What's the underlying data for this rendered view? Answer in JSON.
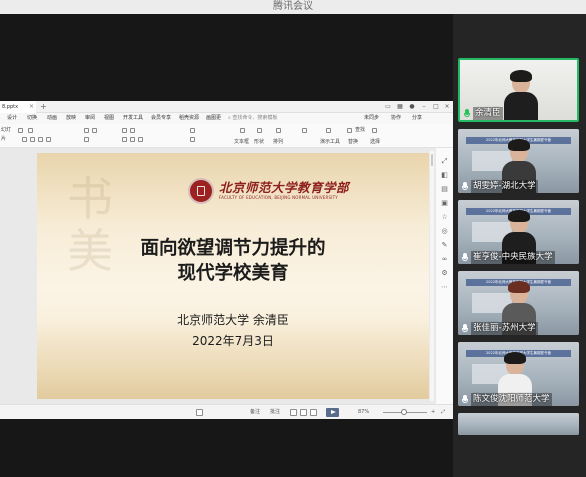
{
  "window": {
    "title": "腾讯会议"
  },
  "presentation_app": {
    "doc_tab": "8.pptx",
    "menu": [
      "设计",
      "切换",
      "动画",
      "放映",
      "审阅",
      "视图",
      "开发工具",
      "会员专享",
      "稻壳资源",
      "画图更"
    ],
    "search_placeholder": "查找命令、搜索模板",
    "menu_right": [
      "未同步",
      "协作",
      "分享"
    ],
    "toolbar_left": [
      "幻灯",
      "片"
    ],
    "toolbar_right": [
      "文本框",
      "形状",
      "排列",
      "演示工具",
      "查找",
      "替换",
      "选择"
    ],
    "status": {
      "notes": "备注",
      "comment": "批注",
      "zoom": "87%"
    }
  },
  "slide": {
    "university_name": "北京师范大学教育学部",
    "university_en": "FACULTY OF EDUCATION, BEIJING NORMAL UNIVERSITY",
    "title_line1": "面向欲望调节力提升的",
    "title_line2": "现代学校美育",
    "author_line": "北京师范大学  余清臣",
    "date": "2022年7月3日"
  },
  "participants": [
    {
      "name": "余清臣",
      "mic": "on",
      "banner": ""
    },
    {
      "name": "胡雯婷-湖北大学",
      "mic": "off",
      "banner": "2022年北师大教育学部大学生暑期夏令营"
    },
    {
      "name": "崔亨俊-中央民族大学",
      "mic": "off",
      "banner": "2022年北师大教育学部大学生暑期夏令营"
    },
    {
      "name": "张佳丽-苏州大学",
      "mic": "off",
      "banner": "2022年北师大教育学部大学生暑期夏令营"
    },
    {
      "name": "陈文俊沈阳师范大学",
      "mic": "off",
      "banner": "2022年北师大教育学部大学生暑期夏令营"
    },
    {
      "name": "",
      "mic": "off",
      "banner": ""
    }
  ],
  "colors": {
    "active_border": "#25b865",
    "mic_on": "#29c15a",
    "seal": "#9c2121"
  }
}
